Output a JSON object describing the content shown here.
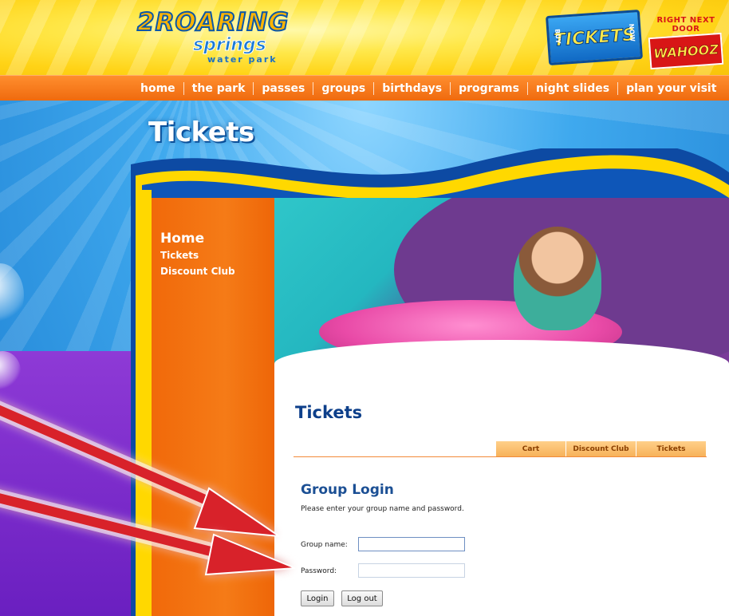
{
  "header": {
    "logo": {
      "main": "ROARING",
      "prefix": "2",
      "sub": "springs",
      "tag": "water park"
    },
    "buy_tickets": {
      "small": "BUY",
      "big": "TICKETS",
      "suffix": "NOW"
    },
    "partner": {
      "top": "RIGHT NEXT DOOR",
      "name": "WAHOOZ"
    }
  },
  "nav": {
    "items": [
      {
        "label": "home"
      },
      {
        "label": "the park"
      },
      {
        "label": "passes"
      },
      {
        "label": "groups"
      },
      {
        "label": "birthdays"
      },
      {
        "label": "programs"
      },
      {
        "label": "night slides"
      },
      {
        "label": "plan your visit"
      }
    ]
  },
  "page": {
    "title": "Tickets"
  },
  "sidebar": {
    "items": [
      {
        "label": "Home"
      },
      {
        "label": "Tickets"
      },
      {
        "label": "Discount Club"
      }
    ]
  },
  "main": {
    "section_title": "Tickets",
    "tabs": [
      {
        "label": "Cart"
      },
      {
        "label": "Discount Club"
      },
      {
        "label": "Tickets"
      }
    ],
    "login": {
      "title": "Group Login",
      "description": "Please enter your group name and password.",
      "group_name_label": "Group name:",
      "group_name_value": "",
      "password_label": "Password:",
      "password_value": "",
      "login_button": "Login",
      "logout_button": "Log out"
    }
  },
  "colors": {
    "nav_orange": "#ef6a0e",
    "header_yellow": "#ffd316",
    "title_blue": "#0d3f8a",
    "tab_orange": "#f7b25a",
    "arrow_red": "#d8232a"
  }
}
